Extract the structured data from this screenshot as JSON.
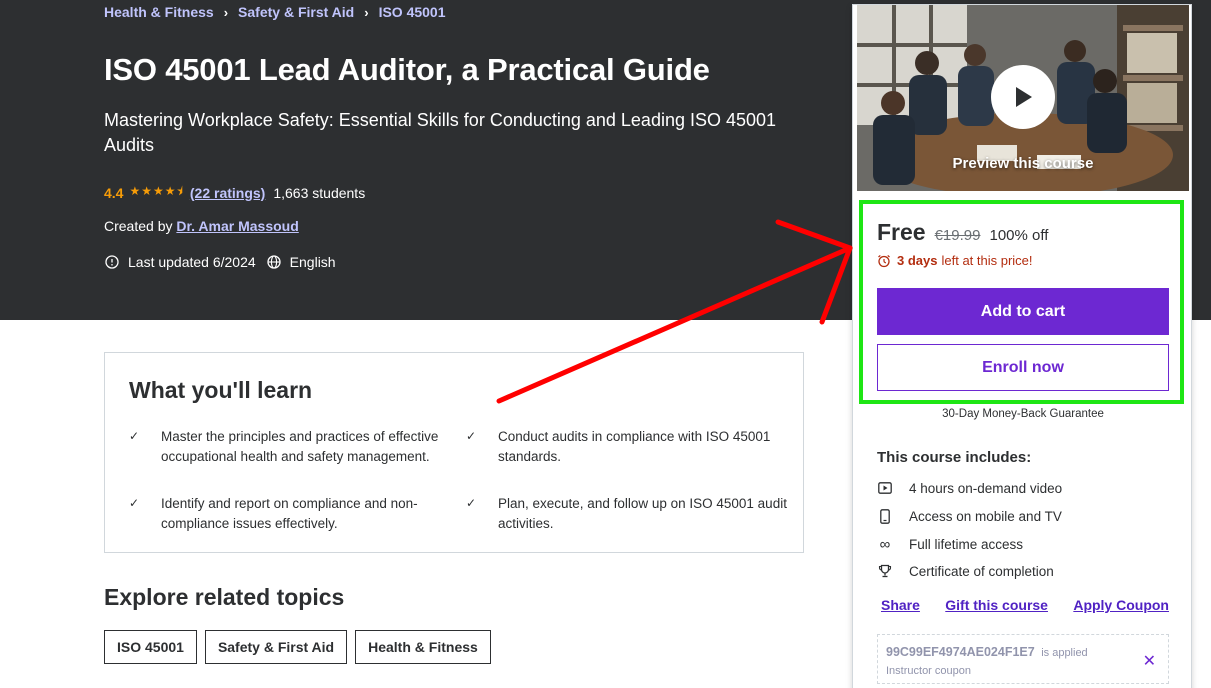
{
  "breadcrumb": [
    "Health & Fitness",
    "Safety & First Aid",
    "ISO 45001"
  ],
  "course": {
    "title": "ISO 45001 Lead Auditor, a Practical Guide",
    "subtitle": "Mastering Workplace Safety: Essential Skills for Conducting and Leading ISO 45001 Audits",
    "rating": "4.4",
    "rating_stars": 4.5,
    "ratings_count": "(22 ratings)",
    "students": "1,663 students",
    "created_by_label": "Created by",
    "author": "Dr. Amar Massoud",
    "last_updated": "Last updated 6/2024",
    "language": "English"
  },
  "learn": {
    "title": "What you'll learn",
    "items": [
      "Master the principles and practices of effective occupational health and safety management.",
      "Conduct audits in compliance with ISO 45001 standards.",
      "Identify and report on compliance and non-compliance issues effectively.",
      "Plan, execute, and follow up on ISO 45001 audit activities."
    ]
  },
  "explore": {
    "title": "Explore related topics",
    "topics": [
      "ISO 45001",
      "Safety & First Aid",
      "Health & Fitness"
    ]
  },
  "sidebar": {
    "preview_label": "Preview this course",
    "price": "Free",
    "original_price": "€19.99",
    "discount": "100% off",
    "timer_bold": "3 days",
    "timer_rest": "left at this price!",
    "add_to_cart": "Add to cart",
    "enroll_now": "Enroll now",
    "guarantee": "30-Day Money-Back Guarantee",
    "includes_title": "This course includes:",
    "includes": [
      {
        "icon": "video-icon",
        "label": "4 hours on-demand video"
      },
      {
        "icon": "mobile-icon",
        "label": "Access on mobile and TV"
      },
      {
        "icon": "infinity-icon",
        "label": "Full lifetime access"
      },
      {
        "icon": "trophy-icon",
        "label": "Certificate of completion"
      }
    ],
    "links": [
      "Share",
      "Gift this course",
      "Apply Coupon"
    ],
    "coupon_code": "99C99EF4974AE024F1E7",
    "coupon_applied": "is applied",
    "coupon_sub": "Instructor coupon"
  },
  "colors": {
    "hero_bg": "#2d2f31",
    "accent": "#6d28d2",
    "rating": "#f69c08",
    "link_light": "#c0c4fc",
    "timer": "#b32d0f",
    "highlight_box": "#1ee614",
    "annotation_arrow": "#ff0000"
  }
}
